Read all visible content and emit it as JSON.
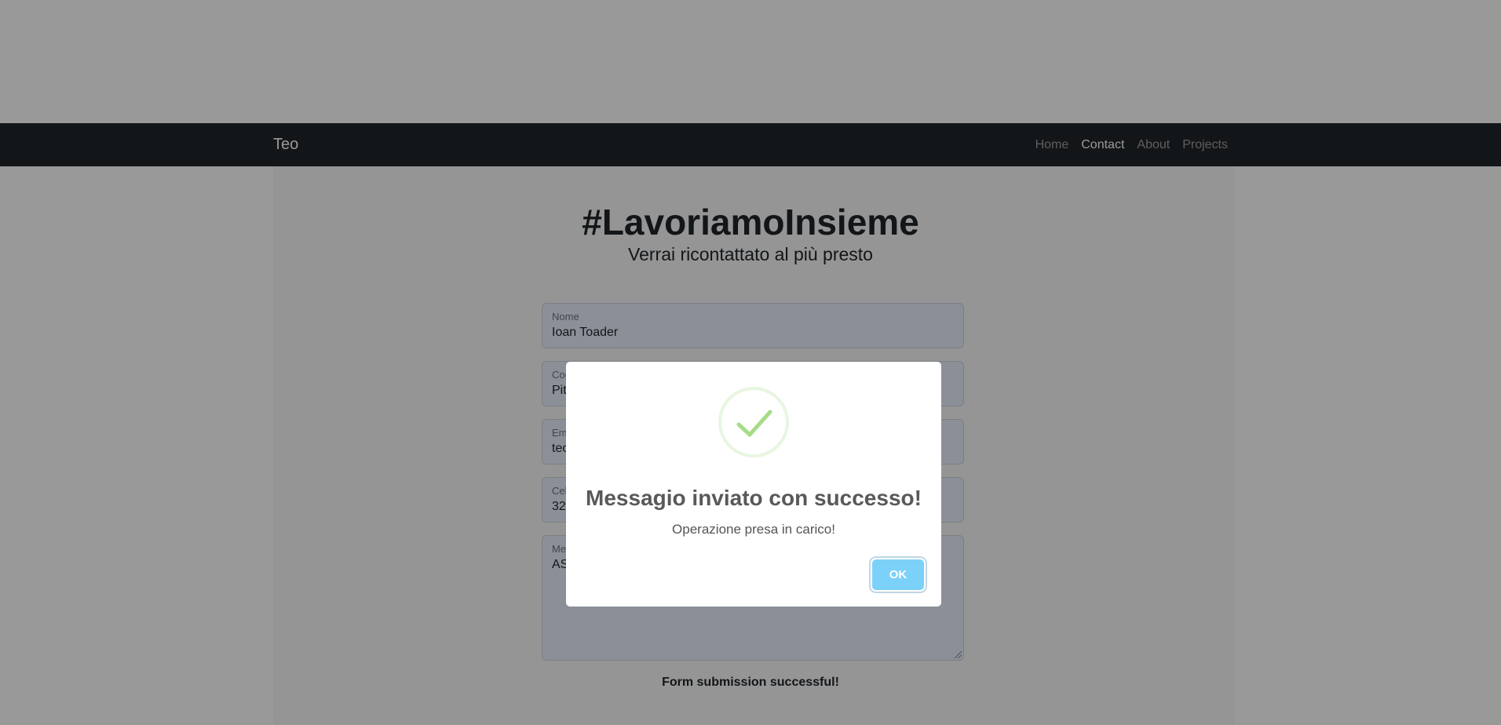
{
  "navbar": {
    "brand": "Teo",
    "links": [
      {
        "label": "Home",
        "active": false
      },
      {
        "label": "Contact",
        "active": true
      },
      {
        "label": "About",
        "active": false
      },
      {
        "label": "Projects",
        "active": false
      }
    ]
  },
  "hero": {
    "title": "#LavoriamoInsieme",
    "subtitle": "Verrai ricontattato al più presto"
  },
  "form": {
    "fields": [
      {
        "label": "Nome",
        "value": "Ioan Toader"
      },
      {
        "label": "Cognome",
        "value": "Pit"
      },
      {
        "label": "Email",
        "value": "teo"
      },
      {
        "label": "Cellulare",
        "value": "32"
      },
      {
        "label": "Messaggio",
        "value": "AS"
      }
    ],
    "status_message": "Form submission successful!"
  },
  "modal": {
    "icon": "success-check-icon",
    "title": "Messagio inviato con successo!",
    "text": "Operazione presa in carico!",
    "ok_label": "OK"
  },
  "colors": {
    "navbar_bg": "#212529",
    "check_green": "#a5dc86",
    "ok_button": "#7cd1f9"
  }
}
